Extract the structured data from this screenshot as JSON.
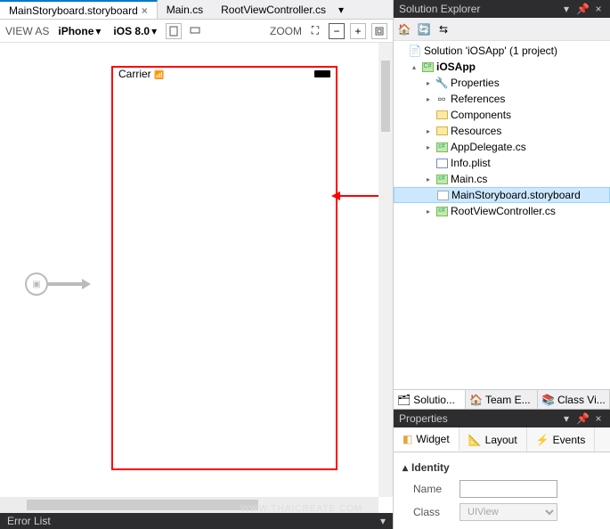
{
  "editor": {
    "tabs": [
      {
        "label": "MainStoryboard.storyboard",
        "active": true
      },
      {
        "label": "Main.cs",
        "active": false
      },
      {
        "label": "RootViewController.cs",
        "active": false
      }
    ]
  },
  "toolbar": {
    "view_as_label": "VIEW AS",
    "device": "iPhone",
    "os": "iOS 8.0",
    "zoom_label": "ZOOM"
  },
  "device_status": {
    "carrier": "Carrier"
  },
  "error_list": {
    "title": "Error List"
  },
  "solution_explorer": {
    "title": "Solution Explorer",
    "root": "Solution 'iOSApp' (1 project)",
    "project": "iOSApp",
    "nodes": {
      "properties": "Properties",
      "references": "References",
      "components": "Components",
      "resources": "Resources",
      "appdelegate": "AppDelegate.cs",
      "infoplist": "Info.plist",
      "maincs": "Main.cs",
      "storyboard": "MainStoryboard.storyboard",
      "rootvc": "RootViewController.cs"
    },
    "bottom_tabs": {
      "solution": "Solutio...",
      "team": "Team E...",
      "classview": "Class Vi..."
    }
  },
  "properties": {
    "title": "Properties",
    "tabs": {
      "widget": "Widget",
      "layout": "Layout",
      "events": "Events"
    },
    "section_identity": "Identity",
    "name_label": "Name",
    "name_value": "",
    "class_label": "Class",
    "class_value": "UIView"
  },
  "watermark": "WWW.THAICREATE.COM"
}
